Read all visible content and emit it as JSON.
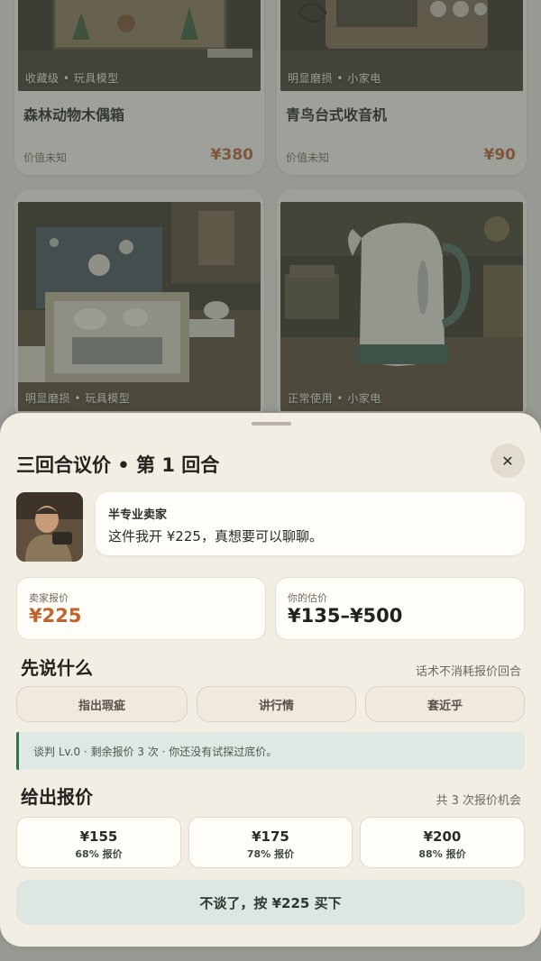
{
  "items": [
    {
      "tag": "收藏级 • 玩具模型",
      "name": "森林动物木偶箱",
      "worth": "价值未知",
      "price": "¥380"
    },
    {
      "tag": "明显磨损 • 小家电",
      "name": "青鸟台式收音机",
      "worth": "价值未知",
      "price": "¥90"
    },
    {
      "tag": "明显磨损 • 玩具模型"
    },
    {
      "tag": "正常使用 • 小家电"
    }
  ],
  "sheet": {
    "title": "三回合议价 • 第 1 回合",
    "close_label": "✕",
    "seller": {
      "role": "半专业卖家",
      "message": "这件我开 ¥225，真想要可以聊聊。"
    },
    "seller_offer": {
      "label": "卖家报价",
      "value": "¥225"
    },
    "your_estimate": {
      "label": "你的估价",
      "value": "¥135–¥500"
    },
    "talk": {
      "heading": "先说什么",
      "note": "话术不消耗报价回合",
      "options": [
        "指出瑕疵",
        "讲行情",
        "套近乎"
      ]
    },
    "hint": "谈判 Lv.0 · 剩余报价 3 次 · 你还没有试探过底价。",
    "offers": {
      "heading": "给出报价",
      "note": "共 3 次报价机会",
      "options": [
        {
          "amount": "¥155",
          "chance": "68% 报价"
        },
        {
          "amount": "¥175",
          "chance": "78% 报价"
        },
        {
          "amount": "¥200",
          "chance": "88% 报价"
        }
      ]
    },
    "accept_label": "不谈了，按 ¥225 买下"
  },
  "colors": {
    "accent_price": "#b9643a",
    "text_dark": "#22211e",
    "sheet_bg": "#f3eee4",
    "hint_border": "#3d6a52"
  }
}
